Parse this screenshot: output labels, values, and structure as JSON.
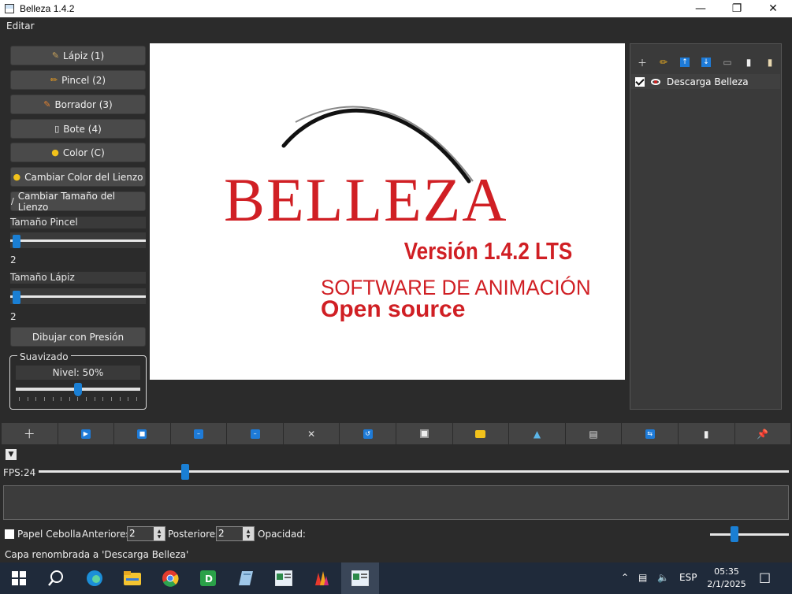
{
  "window": {
    "title": "Belleza 1.4.2"
  },
  "menu": {
    "items": [
      "Editar"
    ]
  },
  "tools": {
    "buttons": [
      {
        "label": "Lápiz (1)",
        "icon": "pencil-icon"
      },
      {
        "label": "Pincel (2)",
        "icon": "brush-icon"
      },
      {
        "label": "Borrador (3)",
        "icon": "eraser-icon"
      },
      {
        "label": "Bote (4)",
        "icon": "bucket-icon"
      },
      {
        "label": "Color (C)",
        "icon": "palette-icon"
      },
      {
        "label": "Cambiar Color del Lienzo",
        "icon": "palette-icon"
      },
      {
        "label": "Cambiar Tamaño del Lienzo",
        "icon": "resize-icon"
      }
    ],
    "brush_size_label": "Tamaño Pincel",
    "brush_size_value": "2",
    "pencil_size_label": "Tamaño Lápiz",
    "pencil_size_value": "2",
    "pressure_button": "Dibujar con Presión",
    "smoothing": {
      "title": "Suavizado",
      "level_label": "Nivel: 50%",
      "level": 0.5
    }
  },
  "canvas": {
    "logo_text": "BELLEZA",
    "version": "Versión 1.4.2 LTS",
    "tagline": "SOFTWARE DE ANIMACIÓN",
    "tagline2": "Open source",
    "accent_color": "#d01f24"
  },
  "layers": {
    "toolbar_icons": [
      "add-layer-icon",
      "rename-layer-icon",
      "move-up-icon",
      "move-down-icon",
      "delete-layer-icon",
      "duplicate-layer-icon",
      "paste-layer-icon"
    ],
    "items": [
      {
        "name": "Descarga Belleza",
        "visible": true,
        "checked": true
      }
    ]
  },
  "timeline": {
    "buttons": [
      "add-frame-icon",
      "play-icon",
      "stop-icon",
      "prev-frame-icon",
      "next-frame-icon",
      "delete-frame-icon",
      "loop-icon",
      "save-icon",
      "open-icon",
      "export-icon",
      "clapper-icon",
      "sync-icon",
      "clipboard-icon",
      "pin-icon"
    ],
    "fps_label": "FPS:",
    "fps_value": "24"
  },
  "onion": {
    "label": "Papel Cebolla",
    "before_label": "Anteriores:",
    "before_value": "2",
    "after_label": "Posteriores:",
    "after_value": "2",
    "opacity_label": "Opacidad:"
  },
  "status": {
    "message": "Capa renombrada a 'Descarga Belleza'"
  },
  "taskbar": {
    "lang": "ESP",
    "time": "05:35",
    "date": "2/1/2025"
  }
}
